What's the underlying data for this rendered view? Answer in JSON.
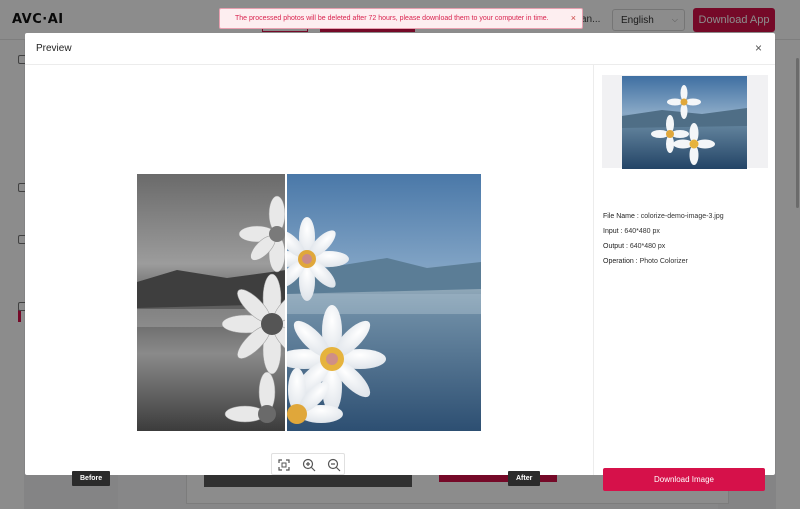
{
  "app": {
    "logo": "AVC·AI",
    "nav_fragment": "an...",
    "language": "English",
    "download_app": "Download App",
    "toast": "The processed photos will be deleted after 72 hours, please download them to your computer in time.",
    "toast_close": "×"
  },
  "modal": {
    "title": "Preview",
    "close": "×",
    "labels": {
      "before": "Before",
      "after": "After"
    },
    "info": {
      "file_name_key": "File Name :",
      "file_name": "colorize-demo-image-3.jpg",
      "input_key": "Input :",
      "input": "640*480 px",
      "output_key": "Output :",
      "output": "640*480 px",
      "operation_key": "Operation :",
      "operation": "Photo Colorizer"
    },
    "download_image": "Download Image",
    "tools": [
      "fit-screen-icon",
      "zoom-in-icon",
      "zoom-out-icon"
    ]
  },
  "colors": {
    "accent": "#d6114a",
    "tag_bg": "#2b2b2b"
  }
}
